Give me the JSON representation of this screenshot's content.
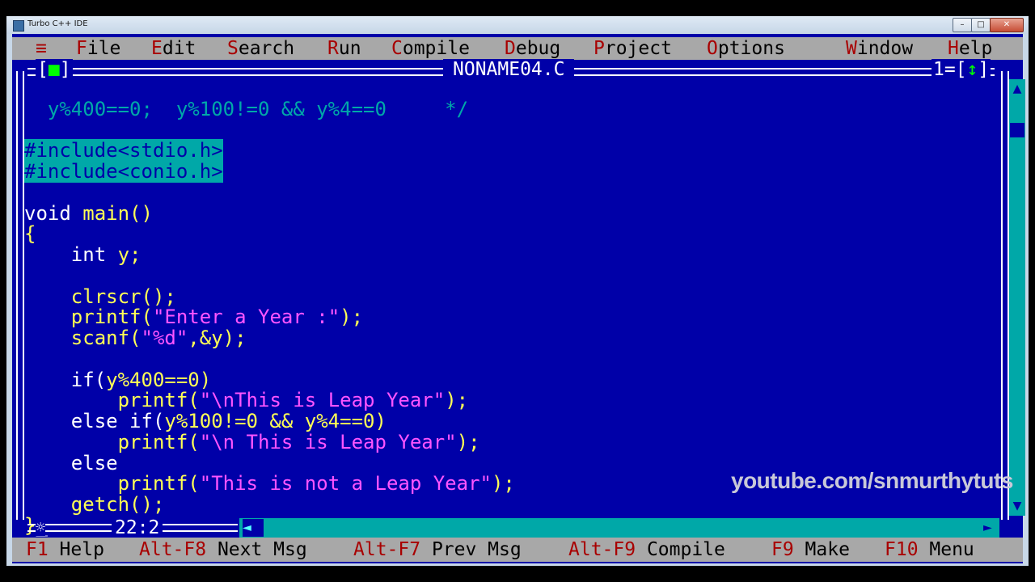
{
  "window": {
    "title": "Turbo C++ IDE",
    "min": "–",
    "max": "□",
    "close": "✕"
  },
  "menu": {
    "system": "≡",
    "items": [
      {
        "hk": "F",
        "rest": "ile"
      },
      {
        "hk": "E",
        "rest": "dit"
      },
      {
        "hk": "S",
        "rest": "earch"
      },
      {
        "hk": "R",
        "rest": "un"
      },
      {
        "hk": "C",
        "rest": "ompile"
      },
      {
        "hk": "D",
        "rest": "ebug"
      },
      {
        "hk": "P",
        "rest": "roject"
      },
      {
        "hk": "O",
        "rest": "ptions"
      },
      {
        "hk": "W",
        "rest": "indow"
      },
      {
        "hk": "H",
        "rest": "elp"
      }
    ]
  },
  "editor": {
    "close_left": "[",
    "close_mark": "■",
    "close_right": "]",
    "filename": "NONAME04.C",
    "window_number": "1=[",
    "zoom_mark": "↕",
    "zoom_right": "]",
    "cursor_position": "22:2",
    "code": {
      "l1": "  y%400==0;  y%100!=0 && y%4==0     */",
      "l2": "#include<stdio.h>",
      "l3": "#include<conio.h>",
      "l4_kw": "void ",
      "l4_id": "main()",
      "l5": "{",
      "l6_kw": "    int ",
      "l6_id": "y;",
      "l7": "    clrscr();",
      "l8_a": "    printf(",
      "l8_s": "\"Enter a Year :\"",
      "l8_b": ");",
      "l9_a": "    scanf(",
      "l9_s": "\"%d\"",
      "l9_b": ",&y);",
      "l10_kw": "    if(",
      "l10_id": "y%400==0",
      "l10_b": ")",
      "l11_a": "        printf(",
      "l11_s": "\"\\nThis is Leap Year\"",
      "l11_b": ");",
      "l12_kw": "    else if(",
      "l12_id": "y%100!=0 && y%4==0",
      "l12_b": ")",
      "l13_a": "        printf(",
      "l13_s": "\"\\n This is Leap Year\"",
      "l13_b": ");",
      "l14": "    else",
      "l15_a": "        printf(",
      "l15_s": "\"This is not a Leap Year\"",
      "l15_b": ");",
      "l16": "    getch();",
      "l17": "}",
      "l17_cursor": "_"
    }
  },
  "scroll": {
    "up": "▲",
    "down": "▼",
    "left": "◄",
    "right": "►"
  },
  "status_bar": [
    {
      "key": "F1",
      "label": " Help"
    },
    {
      "key": "Alt-F8",
      "label": " Next Msg"
    },
    {
      "key": "Alt-F7",
      "label": " Prev Msg"
    },
    {
      "key": "Alt-F9",
      "label": " Compile"
    },
    {
      "key": "F9",
      "label": " Make"
    },
    {
      "key": "F10",
      "label": " Menu"
    }
  ],
  "watermark": "youtube.com/snmurthytuts",
  "colors": {
    "editor_bg": "#0000a8",
    "menu_bg": "#a8a8a8",
    "hotkey": "#a80000",
    "preprocessor_bg": "#00a8a8",
    "string": "#ff55ff",
    "identifier": "#ffff55"
  }
}
